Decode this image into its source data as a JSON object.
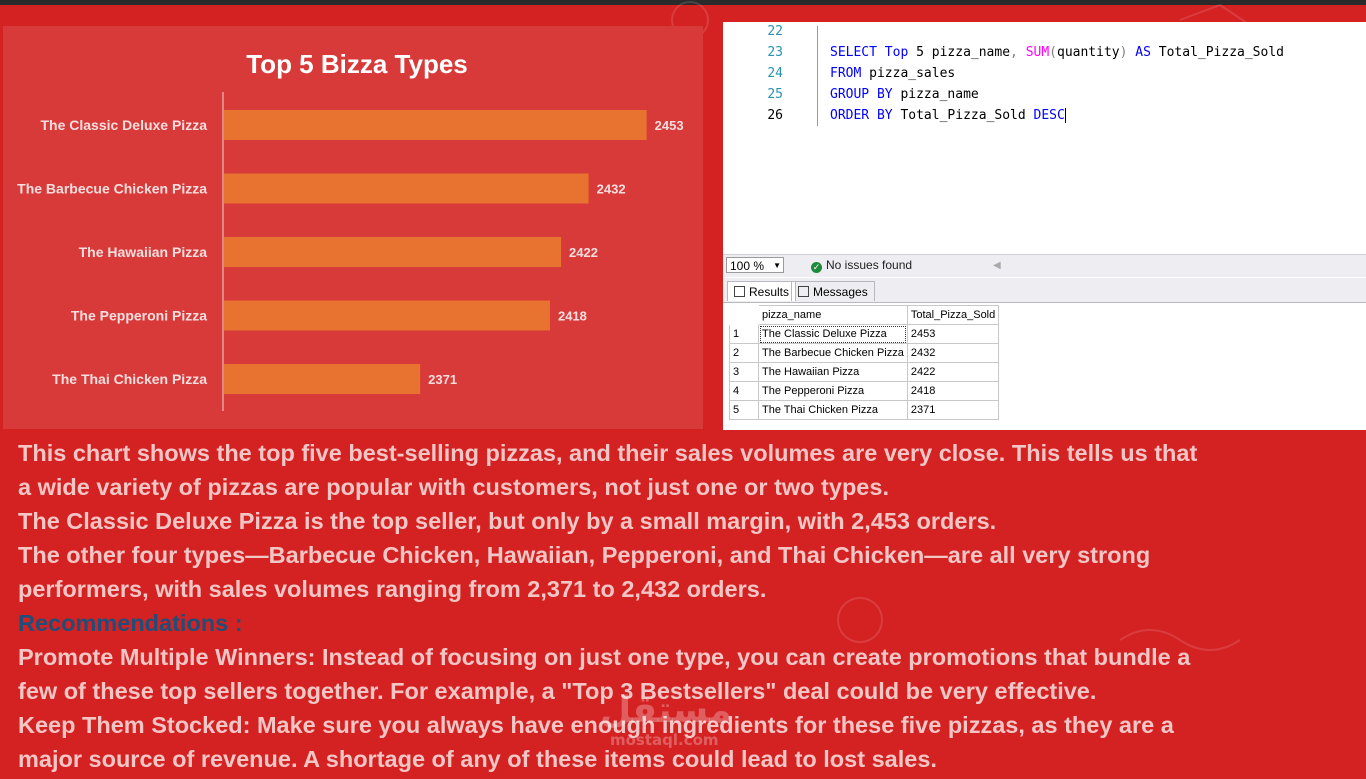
{
  "chart_data": {
    "type": "bar",
    "orientation": "horizontal",
    "title": "Top 5 Bizza Types",
    "categories": [
      "The Classic Deluxe Pizza",
      "The Barbecue Chicken Pizza",
      "The Hawaiian Pizza",
      "The Pepperoni Pizza",
      "The Thai Chicken Pizza"
    ],
    "values": [
      2453,
      2432,
      2422,
      2418,
      2371
    ],
    "data_labels": [
      "2453",
      "2432",
      "2422",
      "2418",
      "2371"
    ],
    "xlim": [
      2300,
      2460
    ],
    "grid": false,
    "legend": "none",
    "bar_color": "#e8722f",
    "background_color": "#d83a3a"
  },
  "sql_editor": {
    "line_numbers": [
      "22",
      "23",
      "24",
      "25",
      "26"
    ],
    "lines": [
      [],
      [
        {
          "t": "SELECT ",
          "c": "kw"
        },
        {
          "t": "Top ",
          "c": "kw"
        },
        {
          "t": "5 pizza_name",
          "c": ""
        },
        {
          "t": ", ",
          "c": "gr"
        },
        {
          "t": "SUM",
          "c": "fn"
        },
        {
          "t": "(",
          "c": "gr"
        },
        {
          "t": "quantity",
          "c": ""
        },
        {
          "t": ") ",
          "c": "gr"
        },
        {
          "t": "AS ",
          "c": "kw"
        },
        {
          "t": "Total_Pizza_Sold",
          "c": ""
        }
      ],
      [
        {
          "t": "FROM ",
          "c": "kw"
        },
        {
          "t": "pizza_sales",
          "c": ""
        }
      ],
      [
        {
          "t": "GROUP BY ",
          "c": "kw"
        },
        {
          "t": "pizza_name",
          "c": ""
        }
      ],
      [
        {
          "t": "ORDER BY ",
          "c": "kw"
        },
        {
          "t": "Total_Pizza_Sold ",
          "c": ""
        },
        {
          "t": "DESC",
          "c": "kw"
        }
      ]
    ],
    "active_line": "26"
  },
  "status": {
    "zoom": "100 %",
    "issues": "No issues found"
  },
  "result_tabs": {
    "results": "Results",
    "messages": "Messages"
  },
  "results_grid": {
    "columns": [
      "pizza_name",
      "Total_Pizza_Sold"
    ],
    "rows": [
      {
        "n": "1",
        "name": "The Classic Deluxe Pizza",
        "total": "2453"
      },
      {
        "n": "2",
        "name": "The Barbecue Chicken Pizza",
        "total": "2432"
      },
      {
        "n": "3",
        "name": "The Hawaiian Pizza",
        "total": "2422"
      },
      {
        "n": "4",
        "name": "The Pepperoni Pizza",
        "total": "2418"
      },
      {
        "n": "5",
        "name": "The Thai Chicken Pizza",
        "total": "2371"
      }
    ]
  },
  "narrative": {
    "line1": "This chart shows the top five best-selling pizzas, and their sales volumes are very close. This tells us that",
    "line2": "a wide variety of pizzas are popular with customers, not just one or two types.",
    "line3": "The Classic Deluxe Pizza is the top seller, but only by a small margin, with 2,453 orders.",
    "line4": "The other four types—Barbecue Chicken, Hawaiian, Pepperoni, and Thai Chicken—are all very strong",
    "line5": "performers, with sales volumes ranging from 2,371 to 2,432 orders.",
    "rec_heading": "Recommendations :",
    "line7": "Promote Multiple Winners: Instead of focusing on just one type, you can create promotions that bundle a",
    "line8": "few of these top sellers together. For example, a \"Top 3 Bestsellers\" deal could be very effective.",
    "line9": "Keep Them Stocked: Make sure you always have enough ingredients for these five pizzas, as they are a",
    "line10": "major source of revenue. A shortage of any of these items could lead to lost sales."
  },
  "watermark": {
    "brand": "مستقل",
    "domain": "mostaql.com"
  },
  "colors": {
    "page_background": "#d42122",
    "narrative_text": "#f3c6c6",
    "recommendations_heading": "#1f4e79",
    "sql_keyword": "#0000ff",
    "sql_function": "#ff00ff"
  }
}
